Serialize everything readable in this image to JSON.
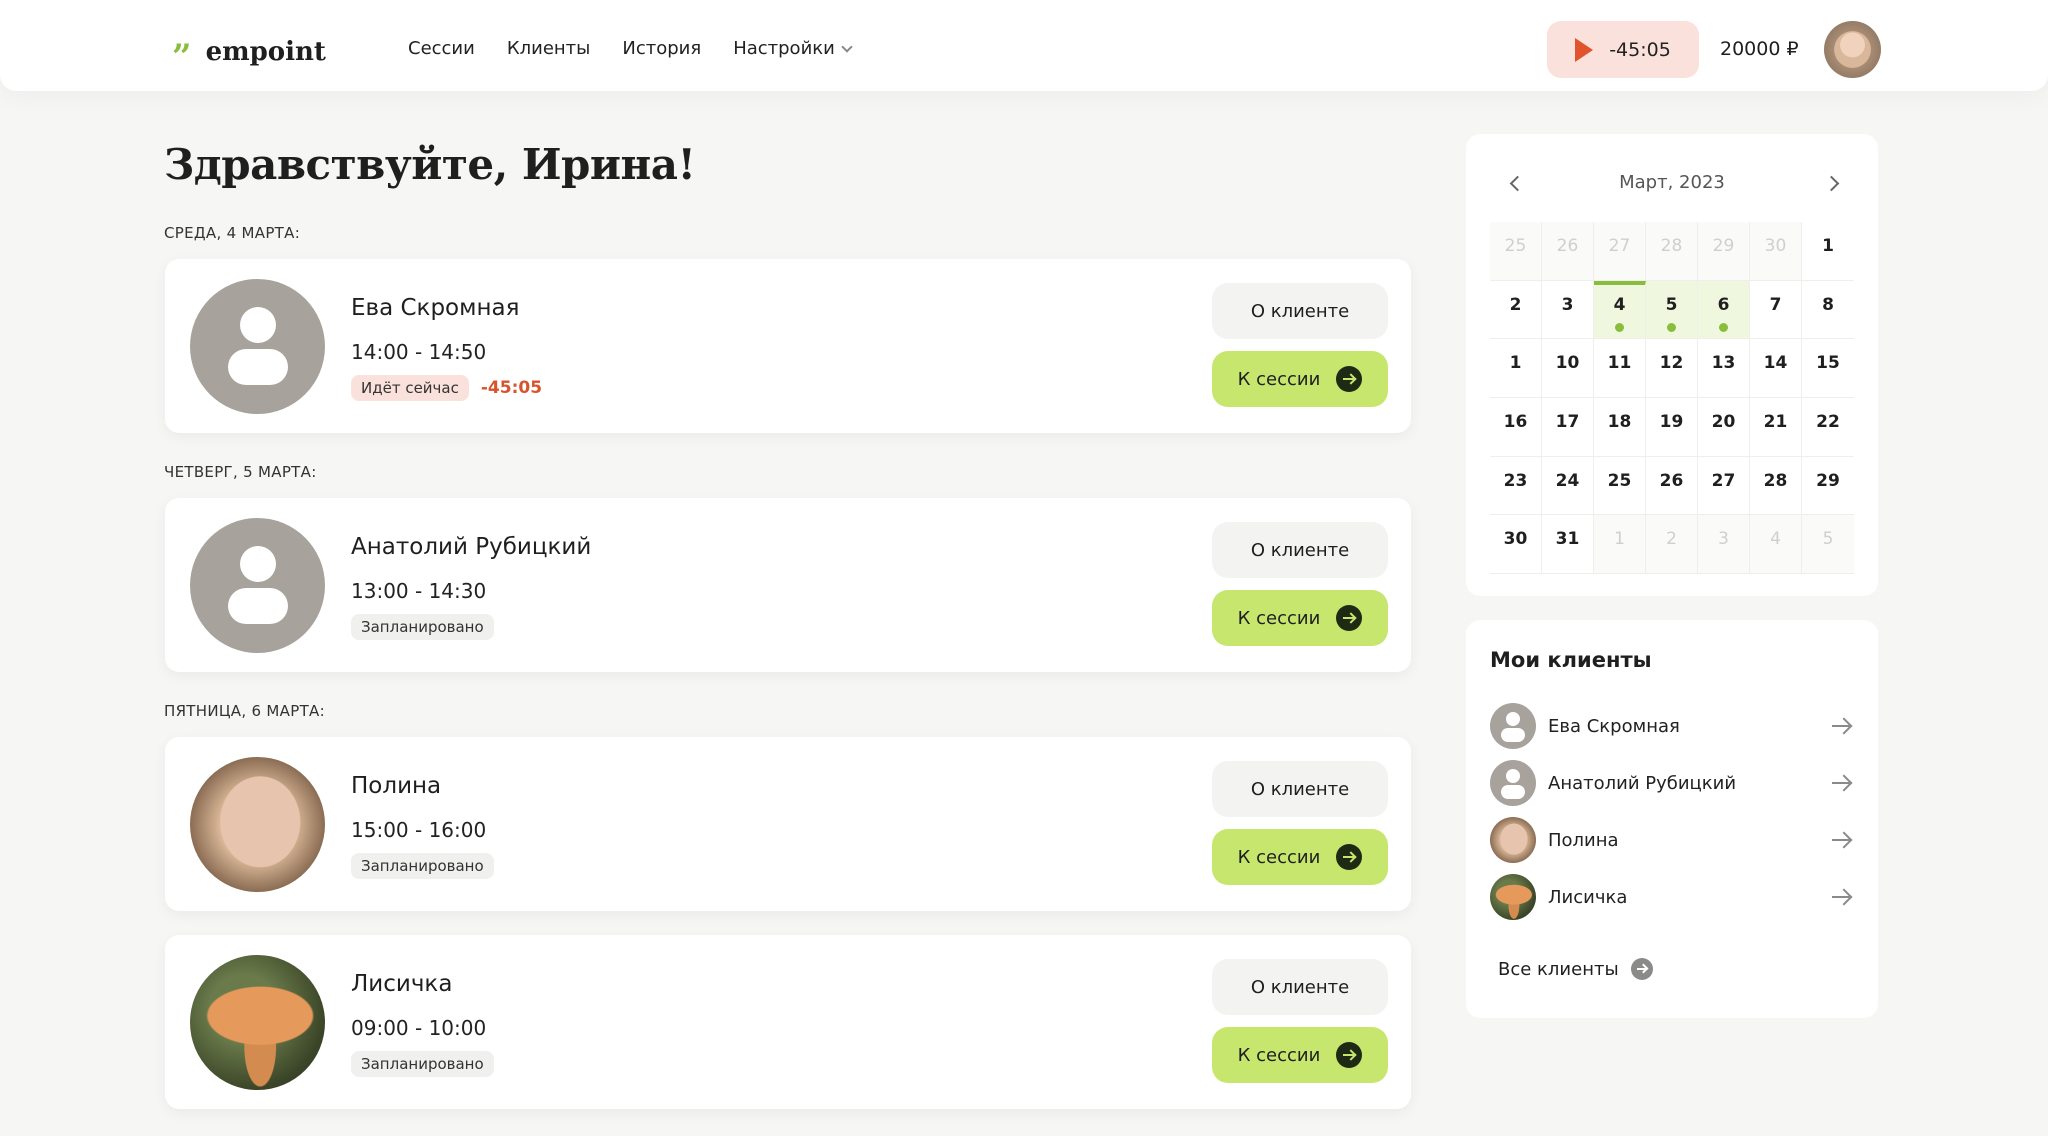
{
  "header": {
    "logo_mark": "”",
    "logo_text": "empoint",
    "nav": [
      "Сессии",
      "Клиенты",
      "История",
      "Настройки"
    ],
    "timer": "-45:05",
    "balance": "20000 ₽",
    "timer_color": "#e0532d"
  },
  "greeting": "Здравствуйте, Ирина!",
  "sessions": [
    {
      "day": "СРЕДА, 4 МАРТА:",
      "name": "Ева Скромная",
      "time": "14:00 - 14:50",
      "status": "Идёт сейчас",
      "countdown": "-45:05",
      "about": "О клиенте",
      "go": "К сессии"
    },
    {
      "day": "ЧЕТВЕРГ, 5 МАРТА:",
      "name": "Анатолий Рубицкий",
      "time": "13:00 - 14:30",
      "status": "Запланировано",
      "about": "О клиенте",
      "go": "К сессии"
    },
    {
      "day": "ПЯТНИЦА, 6 МАРТА:",
      "name": "Полина",
      "time": "15:00 - 16:00",
      "status": "Запланировано",
      "about": "О клиенте",
      "go": "К сессии"
    },
    {
      "name": "Лисичка",
      "time": "09:00 - 10:00",
      "status": "Запланировано",
      "about": "О клиенте",
      "go": "К сессии"
    }
  ],
  "calendar": {
    "month": "Март, 2023",
    "weeks": [
      [
        "25",
        "26",
        "27",
        "28",
        "29",
        "30",
        "1"
      ],
      [
        "2",
        "3",
        "4",
        "5",
        "6",
        "7",
        "8"
      ],
      [
        "1",
        "10",
        "11",
        "12",
        "13",
        "14",
        "15"
      ],
      [
        "16",
        "17",
        "18",
        "19",
        "20",
        "21",
        "22"
      ],
      [
        "23",
        "24",
        "25",
        "26",
        "27",
        "28",
        "29"
      ],
      [
        "30",
        "31",
        "1",
        "2",
        "3",
        "4",
        "5"
      ]
    ],
    "accent": "#8bbd3c"
  },
  "my_clients": {
    "title": "Мои клиенты",
    "items": [
      "Ева Скромная",
      "Анатолий Рубицкий",
      "Полина",
      "Лисичка"
    ],
    "all": "Все клиенты"
  },
  "colors": {
    "go_button": "#c6e66e",
    "live_badge": "#fbe1dc"
  }
}
